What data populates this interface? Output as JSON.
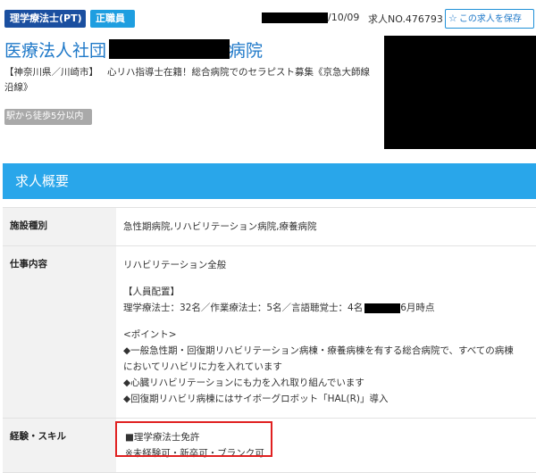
{
  "header": {
    "tag_profession": "理学療法士(PT)",
    "tag_employment": "正職員",
    "date_suffix": "/10/09",
    "job_number": "求人NO.476793",
    "save_button": "この求人を保存",
    "save_icon": "star-outline-icon"
  },
  "title": {
    "prefix": "医療法人社団",
    "suffix": "病院"
  },
  "location": {
    "prefecture_city": "【神奈川県／川崎市】",
    "catchphrase": "心リハ指導士在籍！総合病院でのセラピスト募集《京急大師線沿線》"
  },
  "access_badge": "駅から徒歩5分以内",
  "section": {
    "title": "求人概要"
  },
  "details": {
    "facility_type_label": "施設種別",
    "facility_type_value": "急性期病院,リハビリテーション病院,療養病院",
    "job_content_label": "仕事内容",
    "job_content": {
      "line1": "リハビリテーション全般",
      "staffing_heading": "【人員配置】",
      "staffing_text": "理学療法士：32名／作業療法士：5名／言語聴覚士：4名",
      "staffing_suffix": "6月時点",
      "point_heading": "<ポイント>",
      "point1_a": "◆一般急性期・回復期リハビリテーション病棟・療養病棟を有する総合病院で、すべての病棟",
      "point1_b": "においてリハビリに力を入れています",
      "point2": "◆心臓リハビリテーションにも力を入れ取り組んでいます",
      "point3": "◆回復期リハビリ病棟にはサイボーグロボット「HAL(R)」導入"
    },
    "experience_label": "経験・スキル",
    "experience": {
      "line1": "■理学療法士免許",
      "line2": "※未経験可・新卒可・ブランク可"
    }
  },
  "colors": {
    "brand_blue": "#1e78c8",
    "section_header": "#29a6ea",
    "tag_dark_blue": "#1a4fa0",
    "tag_light_blue": "#1e9ee0",
    "highlight_red": "#e02020"
  }
}
